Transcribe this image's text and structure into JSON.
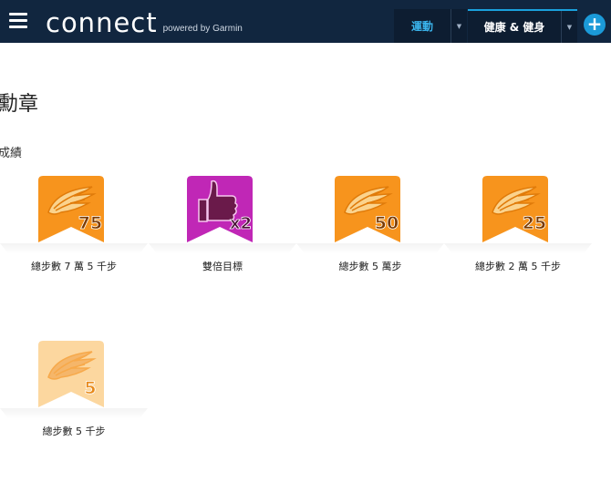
{
  "header": {
    "logo_word": "connect",
    "logo_sub": "powered by Garmin",
    "tabs": [
      {
        "label": "運動",
        "active": false
      },
      {
        "label": "健康 & 健身",
        "active": true
      }
    ],
    "add_label": "+"
  },
  "page": {
    "title": "勳章",
    "section": "成績"
  },
  "badges": [
    {
      "name": "總步數 7 萬 5 千步",
      "number": "75",
      "kind": "wing",
      "faded": false
    },
    {
      "name": "雙倍目標",
      "number": "x2",
      "kind": "thumb",
      "faded": false
    },
    {
      "name": "總步數 5 萬步",
      "number": "50",
      "kind": "wing",
      "faded": false
    },
    {
      "name": "總步數 2 萬 5 千步",
      "number": "25",
      "kind": "wing",
      "faded": false
    },
    {
      "name": "總步數 5 千步",
      "number": "5",
      "kind": "wing",
      "faded": true
    }
  ],
  "colors": {
    "header_bg": "#11263f",
    "accent_blue": "#1aa0dc",
    "badge_orange": "#f7941d",
    "badge_orange_faded": "#fcd79f",
    "badge_purple": "#c027b6"
  },
  "icons": {
    "menu": "hamburger-menu-icon",
    "add": "plus-icon",
    "caret": "caret-down-icon"
  }
}
